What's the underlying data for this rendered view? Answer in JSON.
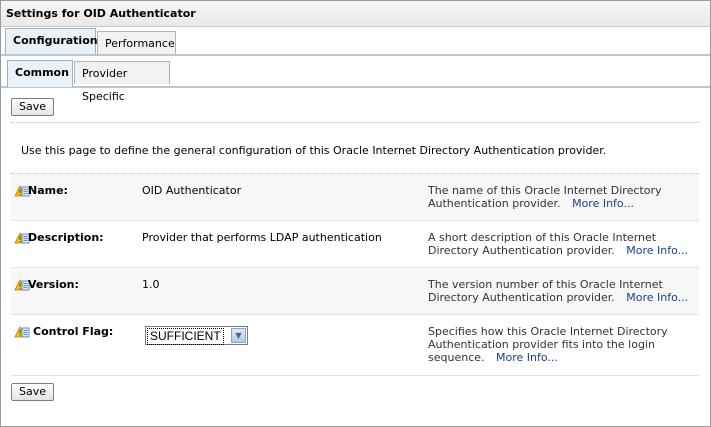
{
  "window": {
    "title": "Settings for OID Authenticator"
  },
  "tabs_primary": [
    {
      "label": "Configuration",
      "active": true
    },
    {
      "label": "Performance",
      "active": false
    }
  ],
  "tabs_secondary": [
    {
      "label": "Common",
      "active": true
    },
    {
      "label": "Provider Specific",
      "active": false
    }
  ],
  "buttons": {
    "save_top": "Save",
    "save_bottom": "Save"
  },
  "intro": "Use this page to define the general configuration of this Oracle Internet Directory Authentication provider.",
  "more_info": "More Info...",
  "fields": [
    {
      "label": "Name:",
      "value": "OID Authenticator",
      "description": "The name of this Oracle Internet Directory Authentication provider.",
      "icon": "warning-info-icon"
    },
    {
      "label": "Description:",
      "value": "Provider that performs LDAP authentication",
      "description": "A short description of this Oracle Internet Directory Authentication provider.",
      "icon": "warning-info-icon"
    },
    {
      "label": "Version:",
      "value": "1.0",
      "description": "The version number of this Oracle Internet Directory Authentication provider.",
      "icon": "warning-info-icon"
    },
    {
      "label": "Control Flag:",
      "value": "SUFFICIENT",
      "description": "Specifies how this Oracle Internet Directory Authentication provider fits into the login sequence.",
      "icon": "warning-info-icon"
    }
  ]
}
